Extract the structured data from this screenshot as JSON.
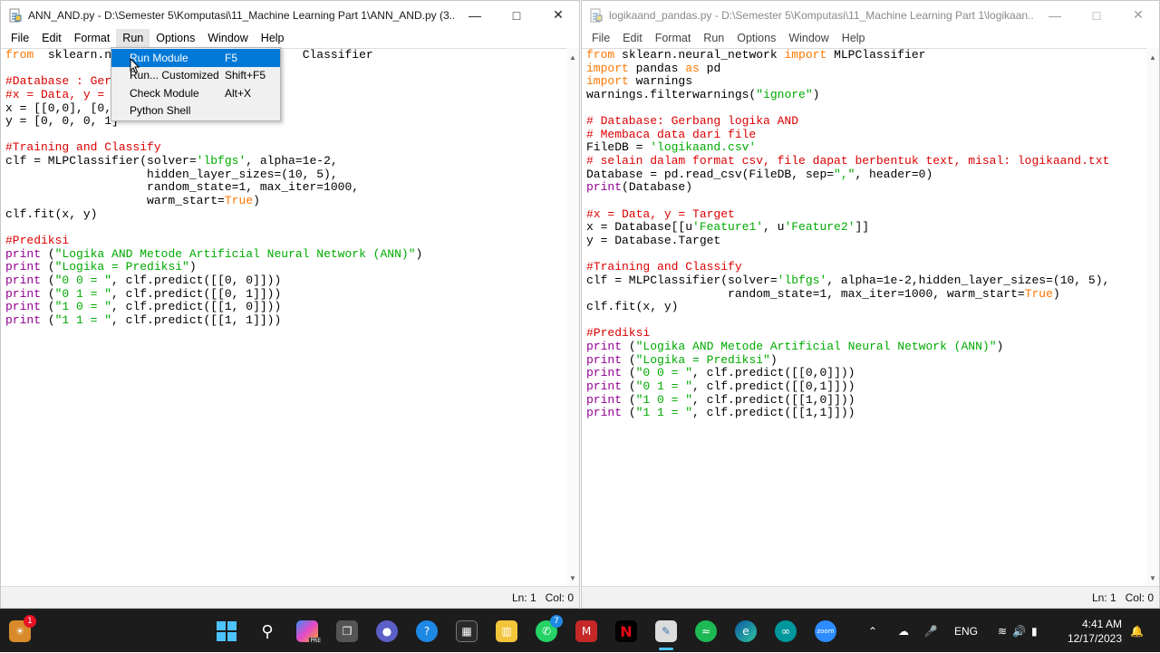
{
  "left_window": {
    "title": "ANN_AND.py - D:\\Semester 5\\Komputasi\\11_Machine Learning Part 1\\ANN_AND.py (3....",
    "menu": [
      "File",
      "Edit",
      "Format",
      "Run",
      "Options",
      "Window",
      "Help"
    ],
    "status": {
      "line": "Ln: 1",
      "col": "Col: 0"
    }
  },
  "right_window": {
    "title": "logikaand_pandas.py - D:\\Semester 5\\Komputasi\\11_Machine Learning Part 1\\logikaan...",
    "menu": [
      "File",
      "Edit",
      "Format",
      "Run",
      "Options",
      "Window",
      "Help"
    ],
    "status": {
      "line": "Ln: 1",
      "col": "Col: 0"
    }
  },
  "run_menu": {
    "items": [
      {
        "label": "Run Module",
        "shortcut": "F5"
      },
      {
        "label": "Run... Customized",
        "shortcut": "Shift+F5"
      },
      {
        "label": "Check Module",
        "shortcut": "Alt+X"
      },
      {
        "label": "Python Shell",
        "shortcut": ""
      }
    ]
  },
  "left_code": [
    [
      [
        "kw",
        "from"
      ],
      [
        "",
        "  sklearn.ne"
      ],
      [
        "",
        "                          "
      ],
      [
        "",
        "Classifier"
      ]
    ],
    [],
    [
      [
        "cm",
        "#Database : Ger"
      ]
    ],
    [
      [
        "cm",
        "#x = Data, y = "
      ]
    ],
    [
      [
        "",
        "x = [[0,0], [0,"
      ]
    ],
    [
      [
        "",
        "y = [0, 0, 0, 1]"
      ]
    ],
    [],
    [
      [
        "cm",
        "#Training and Classify"
      ]
    ],
    [
      [
        "",
        "clf = MLPClassifier(solver="
      ],
      [
        "st",
        "'lbfgs'"
      ],
      [
        "",
        ", alpha=1e-2,"
      ]
    ],
    [
      [
        "",
        "                    hidden_layer_sizes=(10, 5),"
      ]
    ],
    [
      [
        "",
        "                    random_state=1, max_iter=1000,"
      ]
    ],
    [
      [
        "",
        "                    warm_start="
      ],
      [
        "kw",
        "True"
      ],
      [
        "",
        ")"
      ]
    ],
    [
      [
        "",
        "clf.fit(x, y)"
      ]
    ],
    [],
    [
      [
        "cm",
        "#Prediksi"
      ]
    ],
    [
      [
        "bi",
        "print"
      ],
      [
        "",
        " ("
      ],
      [
        "st",
        "\"Logika AND Metode Artificial Neural Network (ANN)\""
      ],
      [
        "",
        ")"
      ]
    ],
    [
      [
        "bi",
        "print"
      ],
      [
        "",
        " ("
      ],
      [
        "st",
        "\"Logika = Prediksi\""
      ],
      [
        "",
        ")"
      ]
    ],
    [
      [
        "bi",
        "print"
      ],
      [
        "",
        " ("
      ],
      [
        "st",
        "\"0 0 = \""
      ],
      [
        "",
        ", clf.predict([[0, 0]]))"
      ]
    ],
    [
      [
        "bi",
        "print"
      ],
      [
        "",
        " ("
      ],
      [
        "st",
        "\"0 1 = \""
      ],
      [
        "",
        ", clf.predict([[0, 1]]))"
      ]
    ],
    [
      [
        "bi",
        "print"
      ],
      [
        "",
        " ("
      ],
      [
        "st",
        "\"1 0 = \""
      ],
      [
        "",
        ", clf.predict([[1, 0]]))"
      ]
    ],
    [
      [
        "bi",
        "print"
      ],
      [
        "",
        " ("
      ],
      [
        "st",
        "\"1 1 = \""
      ],
      [
        "",
        ", clf.predict([[1, 1]]))"
      ]
    ]
  ],
  "right_code": [
    [
      [
        "kw",
        "from"
      ],
      [
        "",
        " sklearn.neural_network "
      ],
      [
        "kw",
        "import"
      ],
      [
        "",
        " MLPClassifier"
      ]
    ],
    [
      [
        "kw",
        "import"
      ],
      [
        "",
        " pandas "
      ],
      [
        "kw",
        "as"
      ],
      [
        "",
        " pd"
      ]
    ],
    [
      [
        "kw",
        "import"
      ],
      [
        "",
        " warnings"
      ]
    ],
    [
      [
        "",
        "warnings.filterwarnings("
      ],
      [
        "st",
        "\"ignore\""
      ],
      [
        "",
        ")"
      ]
    ],
    [],
    [
      [
        "cm",
        "# Database: Gerbang logika AND"
      ]
    ],
    [
      [
        "cm",
        "# Membaca data dari file"
      ]
    ],
    [
      [
        "",
        "FileDB = "
      ],
      [
        "st",
        "'logikaand.csv'"
      ]
    ],
    [
      [
        "cm",
        "# selain dalam format csv, file dapat berbentuk text, misal: logikaand.txt"
      ]
    ],
    [
      [
        "",
        "Database = pd.read_csv(FileDB, sep="
      ],
      [
        "st",
        "\",\""
      ],
      [
        "",
        ", header=0)"
      ]
    ],
    [
      [
        "bi",
        "print"
      ],
      [
        "",
        "(Database)"
      ]
    ],
    [],
    [
      [
        "cm",
        "#x = Data, y = Target"
      ]
    ],
    [
      [
        "",
        "x = Database[[u"
      ],
      [
        "st",
        "'Feature1'"
      ],
      [
        "",
        ", u"
      ],
      [
        "st",
        "'Feature2'"
      ],
      [
        "",
        "]]"
      ]
    ],
    [
      [
        "",
        "y = Database.Target"
      ]
    ],
    [],
    [
      [
        "cm",
        "#Training and Classify"
      ]
    ],
    [
      [
        "",
        "clf = MLPClassifier(solver="
      ],
      [
        "st",
        "'lbfgs'"
      ],
      [
        "",
        ", alpha=1e-2,hidden_layer_sizes=(10, 5),"
      ]
    ],
    [
      [
        "",
        "                    random_state=1, max_iter=1000, warm_start="
      ],
      [
        "kw",
        "True"
      ],
      [
        "",
        ")"
      ]
    ],
    [
      [
        "",
        "clf.fit(x, y)"
      ]
    ],
    [],
    [
      [
        "cm",
        "#Prediksi"
      ]
    ],
    [
      [
        "bi",
        "print"
      ],
      [
        "",
        " ("
      ],
      [
        "st",
        "\"Logika AND Metode Artificial Neural Network (ANN)\""
      ],
      [
        "",
        ")"
      ]
    ],
    [
      [
        "bi",
        "print"
      ],
      [
        "",
        " ("
      ],
      [
        "st",
        "\"Logika = Prediksi\""
      ],
      [
        "",
        ")"
      ]
    ],
    [
      [
        "bi",
        "print"
      ],
      [
        "",
        " ("
      ],
      [
        "st",
        "\"0 0 = \""
      ],
      [
        "",
        ", clf.predict([[0,0]]))"
      ]
    ],
    [
      [
        "bi",
        "print"
      ],
      [
        "",
        " ("
      ],
      [
        "st",
        "\"0 1 = \""
      ],
      [
        "",
        ", clf.predict([[0,1]]))"
      ]
    ],
    [
      [
        "bi",
        "print"
      ],
      [
        "",
        " ("
      ],
      [
        "st",
        "\"1 0 = \""
      ],
      [
        "",
        ", clf.predict([[1,0]]))"
      ]
    ],
    [
      [
        "bi",
        "print"
      ],
      [
        "",
        " ("
      ],
      [
        "st",
        "\"1 1 = \""
      ],
      [
        "",
        ", clf.predict([[1,1]]))"
      ]
    ]
  ],
  "taskbar": {
    "weather_badge": "1",
    "whatsapp_badge": "7",
    "language": "ENG",
    "time": "4:41 AM",
    "date": "12/17/2023",
    "zoom_label": "zoom",
    "copilot_label": "PRE"
  },
  "colors": {
    "keyword": "#ff7700",
    "builtin": "#900090",
    "string": "#00aa00",
    "comment": "#dd0000",
    "menu_highlight": "#0078d7",
    "taskbar": "#1c1c1c"
  }
}
